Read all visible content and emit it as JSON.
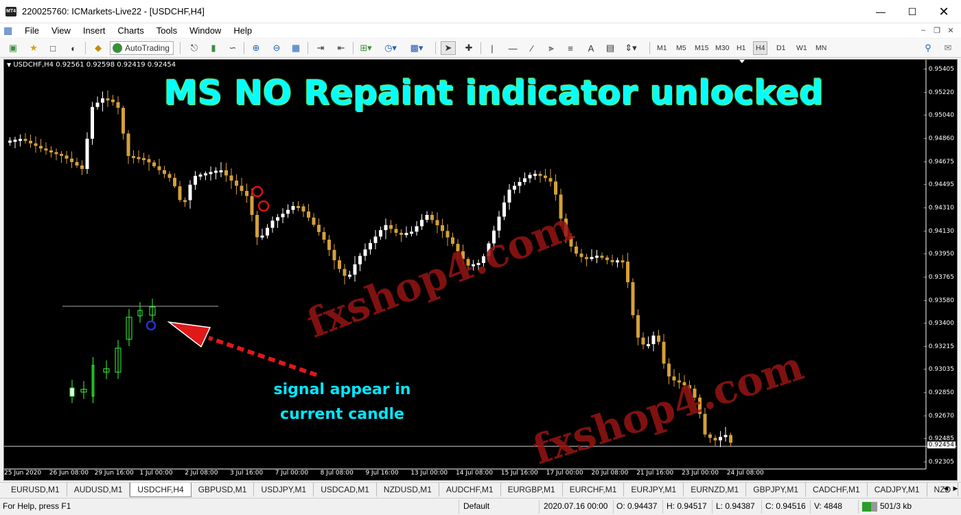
{
  "window": {
    "title": "220025760: ICMarkets-Live22 - [USDCHF,H4]",
    "app_icon_text": "MT4"
  },
  "menu": [
    "File",
    "View",
    "Insert",
    "Charts",
    "Tools",
    "Window",
    "Help"
  ],
  "toolbar": {
    "autotrading_label": "AutoTrading",
    "timeframes": [
      "M1",
      "M5",
      "M15",
      "M30",
      "H1",
      "H4",
      "D1",
      "W1",
      "MN"
    ],
    "active_timeframe": "H4"
  },
  "chart": {
    "info": "USDCHF,H4  0.92561 0.92598 0.92419 0.92454",
    "headline": "MS NO Repaint indicator unlocked",
    "signal_text_line1": "signal appear in",
    "signal_text_line2": "current candle",
    "watermark": "fxshop4.com",
    "current_price": "0.92454",
    "bull_color": "#ffffff",
    "bear_color": "#d4a038",
    "background": "#000000",
    "price_axis": [
      "0.95405",
      "0.95220",
      "0.95040",
      "0.94860",
      "0.94675",
      "0.94495",
      "0.94310",
      "0.94130",
      "0.93950",
      "0.93765",
      "0.93580",
      "0.93400",
      "0.93215",
      "0.93035",
      "0.92850",
      "0.92670",
      "0.92485",
      "0.92305"
    ],
    "time_axis": [
      "25 Jun 2020",
      "26 Jun 08:00",
      "29 Jun 16:00",
      "1 Jul 00:00",
      "2 Jul 08:00",
      "3 Jul 16:00",
      "7 Jul 00:00",
      "8 Jul 08:00",
      "9 Jul 16:00",
      "13 Jul 00:00",
      "14 Jul 08:00",
      "15 Jul 16:00",
      "17 Jul 00:00",
      "20 Jul 08:00",
      "21 Jul 16:00",
      "23 Jul 00:00",
      "24 Jul 08:00"
    ]
  },
  "symbol_tabs": [
    "EURUSD,M1",
    "AUDUSD,M1",
    "USDCHF,H4",
    "GBPUSD,M1",
    "USDJPY,M1",
    "USDCAD,M1",
    "NZDUSD,M1",
    "AUDCHF,M1",
    "EURGBP,M1",
    "EURCHF,M1",
    "EURJPY,M1",
    "EURNZD,M1",
    "GBPJPY,M1",
    "CADCHF,M1",
    "CADJPY,M1",
    "NZD"
  ],
  "active_tab": "USDCHF,H4",
  "status": {
    "help": "For Help, press F1",
    "profile": "Default",
    "datetime": "2020.07.16 00:00",
    "open": "O: 0.94437",
    "high": "H: 0.94517",
    "low": "L: 0.94387",
    "close": "C: 0.94516",
    "volume": "V: 4848",
    "traffic": "501/3 kb"
  }
}
